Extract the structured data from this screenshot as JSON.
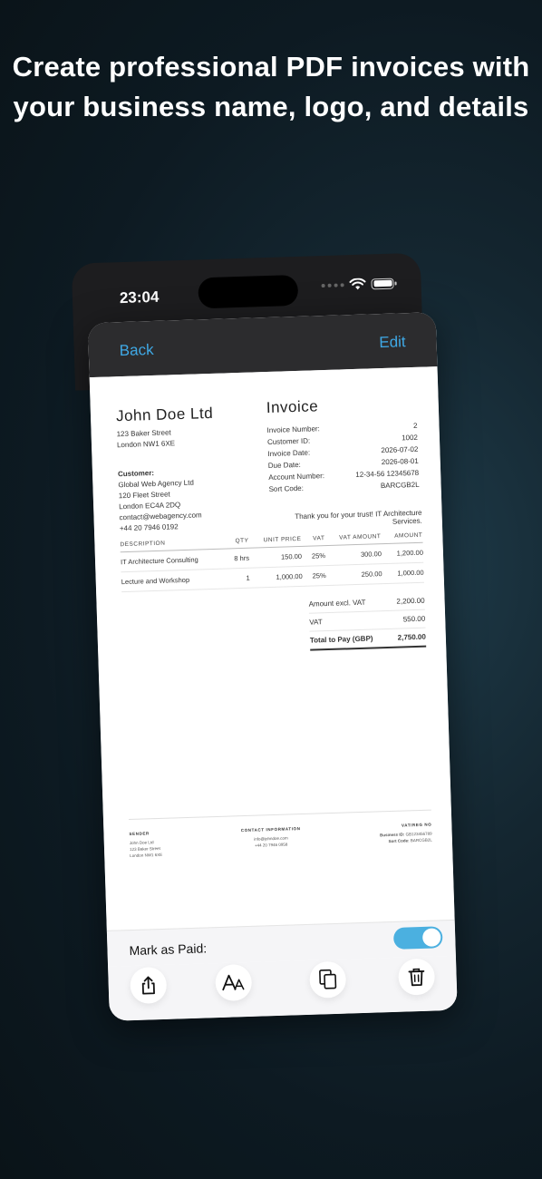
{
  "headline": {
    "line1": "Create professional PDF invoices with",
    "line2": "your business name, logo, and details"
  },
  "status_bar": {
    "time": "23:04"
  },
  "nav": {
    "back_label": "Back",
    "edit_label": "Edit"
  },
  "invoice": {
    "company": {
      "name": "John Doe Ltd",
      "address1": "123 Baker Street",
      "address2": "London NW1 6XE"
    },
    "title": "Invoice",
    "meta": [
      {
        "label": "Invoice Number:",
        "value": "2"
      },
      {
        "label": "Customer ID:",
        "value": "1002"
      },
      {
        "label": "Invoice Date:",
        "value": "2026-07-02"
      },
      {
        "label": "Due Date:",
        "value": "2026-08-01"
      },
      {
        "label": "Account Number:",
        "value": "12-34-56 12345678"
      },
      {
        "label": "Sort Code:",
        "value": "BARCGB2L"
      }
    ],
    "customer": {
      "label": "Customer:",
      "name": "Global Web Agency Ltd",
      "address1": "120 Fleet Street",
      "address2": "London EC4A 2DQ",
      "email": "contact@webagency.com",
      "phone": "+44 20 7946 0192"
    },
    "thanks": "Thank you for your trust! IT Architecture Services.",
    "columns": {
      "desc": "DESCRIPTION",
      "qty": "QTY",
      "unit": "UNIT PRICE",
      "vat": "VAT",
      "vat_amount": "VAT AMOUNT",
      "amount": "AMOUNT"
    },
    "items": [
      {
        "desc": "IT Architecture Consulting",
        "qty": "8 hrs",
        "unit": "150.00",
        "vat": "25%",
        "vat_amount": "300.00",
        "amount": "1,200.00"
      },
      {
        "desc": "Lecture and Workshop",
        "qty": "1",
        "unit": "1,000.00",
        "vat": "25%",
        "vat_amount": "250.00",
        "amount": "1,000.00"
      }
    ],
    "totals": {
      "excl_label": "Amount excl. VAT",
      "excl_value": "2,200.00",
      "vat_label": "VAT",
      "vat_value": "550.00",
      "total_label": "Total to Pay (GBP)",
      "total_value": "2,750.00"
    },
    "footer": {
      "sender_title": "SENDER",
      "sender_line1": "John Doe Ltd",
      "sender_line2": "123 Baker Street",
      "sender_line3": "London NW1 6XE",
      "contact_title": "CONTACT INFORMATION",
      "contact_email": "info@johndoe.com",
      "contact_phone": "+44 20 7946 0958",
      "vat_title": "VAT/REG NO",
      "business_id_label": "Business ID:",
      "business_id_value": "GB123456789",
      "sort_code_label": "Sort Code:",
      "sort_code_value": "BARCGB2L"
    }
  },
  "mark_paid": {
    "label": "Mark as Paid:",
    "on": true
  },
  "actions": [
    {
      "name": "share-icon"
    },
    {
      "name": "font-size-icon"
    },
    {
      "name": "copy-icon"
    },
    {
      "name": "trash-icon"
    }
  ],
  "colors": {
    "accent": "#3fa9e6",
    "toggle_on": "#4bb0e0"
  }
}
